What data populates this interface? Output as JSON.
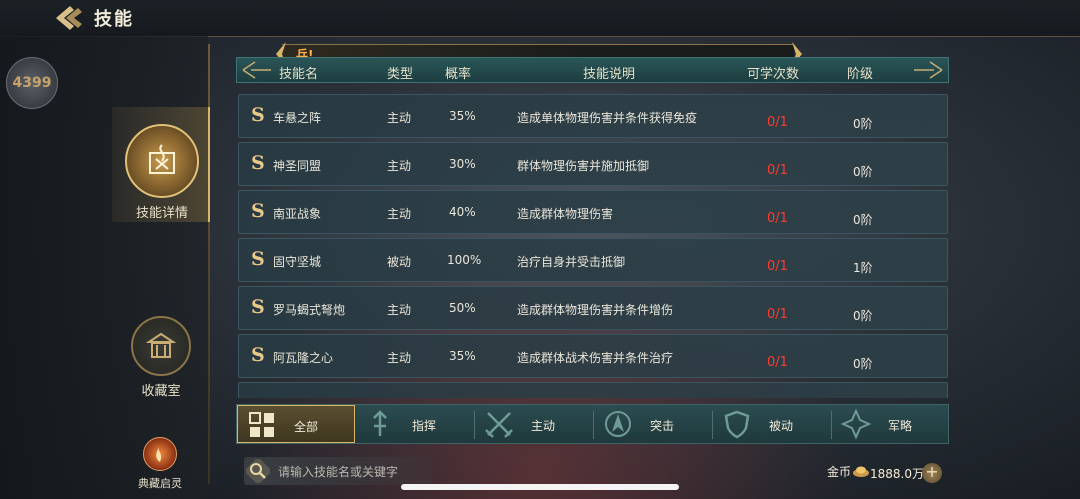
{
  "header": {
    "title": "技能"
  },
  "sidebar": {
    "avatar_text": "4399",
    "items": [
      {
        "label": "技能详情",
        "active": true
      },
      {
        "label": "收藏室",
        "active": false
      },
      {
        "label": "典藏启灵",
        "active": false
      }
    ]
  },
  "skills": {
    "tag": "兵!",
    "columns": [
      "技能名",
      "类型",
      "概率",
      "技能说明",
      "可学次数",
      "阶级"
    ],
    "rows": [
      {
        "grade": "S",
        "name": "车悬之阵",
        "type": "主动",
        "rate": "35%",
        "desc": "造成单体物理伤害并条件获得免疫",
        "count": "0/1",
        "tier": "0阶"
      },
      {
        "grade": "S",
        "name": "神圣同盟",
        "type": "主动",
        "rate": "30%",
        "desc": "群体物理伤害并施加抵御",
        "count": "0/1",
        "tier": "0阶"
      },
      {
        "grade": "S",
        "name": "南亚战象",
        "type": "主动",
        "rate": "40%",
        "desc": "造成群体物理伤害",
        "count": "0/1",
        "tier": "0阶"
      },
      {
        "grade": "S",
        "name": "固守坚城",
        "type": "被动",
        "rate": "100%",
        "desc": "治疗自身并受击抵御",
        "count": "0/1",
        "tier": "1阶"
      },
      {
        "grade": "S",
        "name": "罗马蝎式弩炮",
        "type": "主动",
        "rate": "50%",
        "desc": "造成群体物理伤害并条件增伤",
        "count": "0/1",
        "tier": "0阶"
      },
      {
        "grade": "S",
        "name": "阿瓦隆之心",
        "type": "主动",
        "rate": "35%",
        "desc": "造成群体战术伤害并条件治疗",
        "count": "0/1",
        "tier": "0阶"
      }
    ]
  },
  "filters": [
    {
      "label": "全部",
      "icon": "grid-icon",
      "active": true
    },
    {
      "label": "指挥",
      "icon": "command-icon",
      "active": false
    },
    {
      "label": "主动",
      "icon": "crossed-swords-icon",
      "active": false
    },
    {
      "label": "突击",
      "icon": "charge-icon",
      "active": false
    },
    {
      "label": "被动",
      "icon": "shield-icon",
      "active": false
    },
    {
      "label": "军略",
      "icon": "strategy-icon",
      "active": false
    }
  ],
  "search": {
    "placeholder": "请输入技能名或关键字"
  },
  "currency": {
    "label": "金币",
    "value": "1888.0万"
  },
  "colors": {
    "accent_gold": "#d9b567",
    "count_red": "#ff3b30",
    "header_teal": "#2a5658"
  }
}
